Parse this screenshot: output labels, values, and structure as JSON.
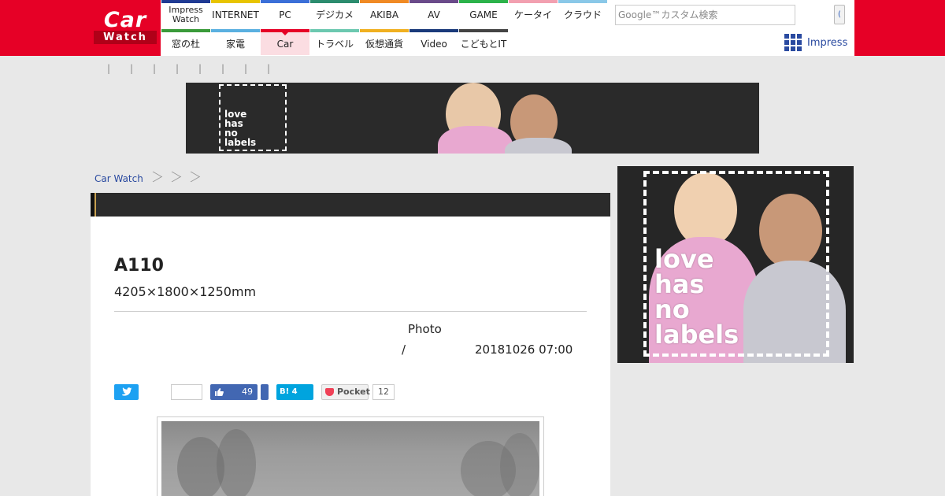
{
  "header": {
    "logo_top": "Car",
    "logo_bottom": "Watch",
    "nav_row1": [
      {
        "label": "Impress Watch",
        "color": "#1f3a93",
        "small": true
      },
      {
        "label": "INTERNET",
        "color": "#e8c400"
      },
      {
        "label": "PC",
        "color": "#3b6fd8"
      },
      {
        "label": "デジカメ",
        "color": "#2b8c6e"
      },
      {
        "label": "AKIBA",
        "color": "#f08a24"
      },
      {
        "label": "AV",
        "color": "#6a4a8a"
      },
      {
        "label": "GAME",
        "color": "#2cb34a"
      },
      {
        "label": "ケータイ",
        "color": "#f2a0b0"
      },
      {
        "label": "クラウド",
        "color": "#8ac8e8"
      }
    ],
    "nav_row2": [
      {
        "label": "窓の杜",
        "color": "#3a9a3a"
      },
      {
        "label": "家電",
        "color": "#5ab0e0"
      },
      {
        "label": "Car",
        "color": "#e60026",
        "active": true
      },
      {
        "label": "トラベル",
        "color": "#6cc8b0"
      },
      {
        "label": "仮想通貨",
        "color": "#f0b020"
      },
      {
        "label": "Video",
        "color": "#1a3a7a"
      },
      {
        "label": "こどもとIT",
        "color": "#444444"
      }
    ],
    "search_placeholder": "Google™カスタム検索",
    "search_button": "(",
    "impress_label": "Impress"
  },
  "subnav_separators": [
    "|",
    "|",
    "|",
    "|",
    "|",
    "|",
    "|",
    "|"
  ],
  "ads": {
    "top_banner_text": [
      "love",
      "has",
      "no",
      "labels"
    ],
    "sidebar_text": [
      "love",
      "has",
      "no",
      "labels"
    ]
  },
  "breadcrumb": {
    "home": "Car Watch"
  },
  "article": {
    "title": "A110",
    "subtitle": "4205×1800×1250mm",
    "photo_label": "Photo",
    "slash": "/",
    "date": "20181026 07:00"
  },
  "share": {
    "facebook_count": "49",
    "hatena_label": "B! 4",
    "pocket_label": "Pocket",
    "pocket_count": "12"
  }
}
